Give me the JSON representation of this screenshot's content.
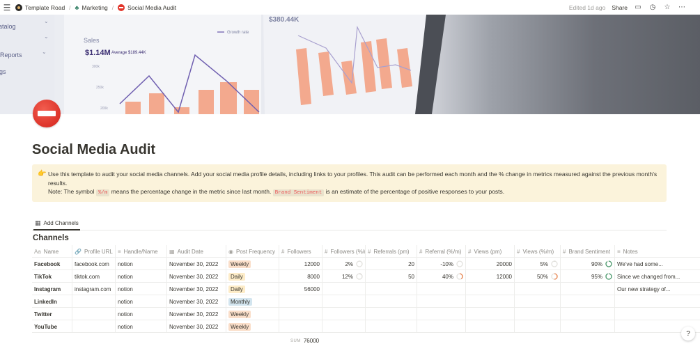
{
  "breadcrumbs": [
    {
      "label": "Template Road",
      "icon": "workspace-logo-icon"
    },
    {
      "label": "Marketing",
      "icon": "marketing-icon"
    },
    {
      "label": "Social Media Audit",
      "icon": "stop-sign-icon"
    }
  ],
  "topbar": {
    "edited": "Edited 1d ago",
    "share": "Share"
  },
  "cover_text": {
    "catalog": "atalog",
    "reports": "Reports",
    "settings": "gs",
    "sales_label": "Sales",
    "sales_value": "$1.14M",
    "average": "Average $189.44K",
    "growth_rate": "Growth rate",
    "second_value": "$380.44K",
    "tick_300": "300k",
    "tick_250": "250k",
    "tick_200": "200k"
  },
  "page": {
    "title": "Social Media Audit"
  },
  "callout": {
    "icon": "pointing-hand-icon",
    "line1": "Use this template to audit your social media channels. Add your social media profile details, including links to your profiles. This audit can be performed each month and the % change in metrics measured against the previous month's results.",
    "note_prefix": "Note: The symbol ",
    "code1": "%/m",
    "note_mid": " means the percentage change in the metric since last month. ",
    "code2": "Brand Sentiment",
    "note_suffix": " is an estimate of the percentage of positive responses to your posts."
  },
  "view_tab": "Add Channels",
  "database_title": "Channels",
  "columns": [
    {
      "label": "Name",
      "icon": "Aa"
    },
    {
      "label": "Profile URL",
      "icon": "🔗"
    },
    {
      "label": "Handle/Name",
      "icon": "≡"
    },
    {
      "label": "Audit Date",
      "icon": "▦"
    },
    {
      "label": "Post Frequency",
      "icon": "◉"
    },
    {
      "label": "Followers",
      "icon": "#"
    },
    {
      "label": "Followers (%/m)",
      "icon": "#"
    },
    {
      "label": "Referrals (pm)",
      "icon": "#"
    },
    {
      "label": "Referral (%/m)",
      "icon": "#"
    },
    {
      "label": "Views (pm)",
      "icon": "#"
    },
    {
      "label": "Views (%/m)",
      "icon": "#"
    },
    {
      "label": "Brand Sentiment",
      "icon": "#"
    },
    {
      "label": "Notes",
      "icon": "≡"
    }
  ],
  "rows": [
    {
      "name": "Facebook",
      "url": "facebook.com",
      "handle": "notion",
      "date": "November 30, 2022",
      "freq": "Weekly",
      "followers": "12000",
      "followers_pct": "2%",
      "followers_pct_value": 0.02,
      "referrals": "20",
      "referral_pct": "-10%",
      "referral_pct_value": 0.0,
      "views": "20000",
      "views_pct": "5%",
      "views_pct_value": 0.05,
      "sentiment": "90%",
      "sentiment_value": 0.9,
      "notes": "We've had some..."
    },
    {
      "name": "TikTok",
      "url": "tiktok.com",
      "handle": "notion",
      "date": "November 30, 2022",
      "freq": "Daily",
      "followers": "8000",
      "followers_pct": "12%",
      "followers_pct_value": 0.12,
      "referrals": "50",
      "referral_pct": "40%",
      "referral_pct_value": 0.4,
      "views": "12000",
      "views_pct": "50%",
      "views_pct_value": 0.5,
      "sentiment": "95%",
      "sentiment_value": 0.95,
      "notes": "Since we changed from..."
    },
    {
      "name": "Instagram",
      "url": "instagram.com",
      "handle": "notion",
      "date": "November 30, 2022",
      "freq": "Daily",
      "followers": "56000",
      "followers_pct": "",
      "referrals": "",
      "referral_pct": "",
      "views": "",
      "views_pct": "",
      "sentiment": "",
      "notes": "Our new strategy of..."
    },
    {
      "name": "LinkedIn",
      "url": "",
      "handle": "notion",
      "date": "November 30, 2022",
      "freq": "Monthly",
      "followers": "",
      "followers_pct": "",
      "referrals": "",
      "referral_pct": "",
      "views": "",
      "views_pct": "",
      "sentiment": "",
      "notes": ""
    },
    {
      "name": "Twitter",
      "url": "",
      "handle": "notion",
      "date": "November 30, 2022",
      "freq": "Weekly",
      "followers": "",
      "followers_pct": "",
      "referrals": "",
      "referral_pct": "",
      "views": "",
      "views_pct": "",
      "sentiment": "",
      "notes": ""
    },
    {
      "name": "YouTube",
      "url": "",
      "handle": "notion",
      "date": "November 30, 2022",
      "freq": "Weekly",
      "followers": "",
      "followers_pct": "",
      "referrals": "",
      "referral_pct": "",
      "views": "",
      "views_pct": "",
      "sentiment": "",
      "notes": ""
    }
  ],
  "freq_colors": {
    "Weekly": "tag-orange",
    "Daily": "tag-yellow",
    "Monthly": "tag-blue"
  },
  "ring_colors": {
    "low": "#d3d1cb",
    "mid": "#e9834d",
    "high": "#4d9c6f"
  },
  "footer": {
    "sum_label": "SUM",
    "sum_value": "76000"
  },
  "help": "?"
}
